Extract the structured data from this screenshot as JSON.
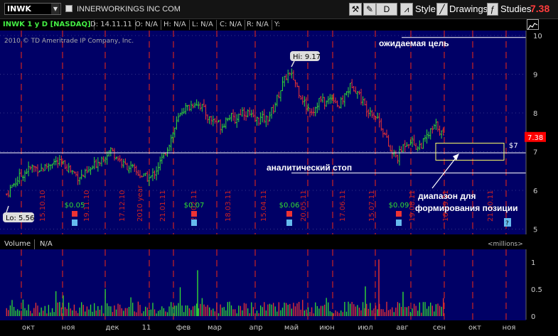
{
  "toolbar": {
    "symbol": "INWK",
    "company": "INNERWORKINGS INC COM",
    "period_button": "D",
    "style_label": "Style",
    "drawings_label": "Drawings",
    "studies_label": "Studies",
    "last_price": "7.38"
  },
  "infobar": {
    "title": "INWK 1 y D [NASDAQ]",
    "date": "D: 14.11.11",
    "open": "O: N/A",
    "high": "H: N/A",
    "low": "L: N/A",
    "close": "C: N/A",
    "range": "R: N/A",
    "y": "Y:"
  },
  "copyright": "2010 © TD Ameritrade IP Company, Inc.",
  "colors": {
    "background": "#000066",
    "up_bar": "#33dd33",
    "down_bar": "#ee3333",
    "grid_dashed": "#cc2222",
    "annotation": "#ffffff",
    "position_box": "#ffff66",
    "price_tag": "#ff0000"
  },
  "chart_data": {
    "type": "ohlc",
    "price_axis": {
      "ticks": [
        "10",
        "9",
        "8",
        "7",
        "6",
        "5"
      ],
      "range": [
        5,
        10.1
      ]
    },
    "month_labels": [
      "окт",
      "ноя",
      "дек",
      "11",
      "фев",
      "мар",
      "апр",
      "май",
      "июн",
      "июл",
      "авг",
      "сен",
      "окт",
      "ноя"
    ],
    "date_labels": [
      "15.10.10",
      "19.11.10",
      "17.12.10",
      "2010 year",
      "21.01.11",
      "21.02.11",
      "18.03.11",
      "15.04.11",
      "20.05.11",
      "17.06.11",
      "15.07.11",
      "19.08.11",
      "16.09.11",
      "21.10.11"
    ],
    "dividend_labels": [
      "$0.05",
      "$0.07",
      "$0.06",
      "$0.09"
    ],
    "hi_label": "Hi: 9.17",
    "lo_label": "Lo: 5.56",
    "close_series": [
      5.9,
      6.15,
      6.35,
      6.5,
      6.6,
      6.55,
      6.6,
      6.75,
      6.7,
      6.65,
      6.5,
      6.35,
      6.4,
      6.55,
      6.75,
      6.9,
      7.05,
      6.85,
      6.65,
      6.6,
      6.45,
      6.35,
      6.3,
      6.55,
      6.85,
      7.25,
      7.7,
      8.1,
      8.15,
      8.3,
      8.15,
      7.85,
      7.8,
      7.65,
      7.95,
      7.8,
      8.05,
      8.0,
      7.8,
      7.85,
      7.85,
      8.15,
      8.6,
      9.0,
      8.9,
      8.5,
      8.15,
      8.05,
      8.35,
      8.25,
      8.45,
      8.15,
      8.5,
      8.75,
      8.5,
      8.15,
      8.05,
      7.85,
      7.45,
      6.95,
      6.85,
      7.2,
      7.3,
      7.1,
      7.25,
      7.5,
      7.7,
      7.38
    ],
    "annotations": {
      "target_label": "ожидаемая цель",
      "stop_label": "аналитический стоп",
      "range_label_1": "диапазон для",
      "range_label_2": "формирования позиции",
      "box_price_label": "$7",
      "target_price": 9.95,
      "stop_price": 6.45,
      "support_price": 6.97,
      "box_low": 6.78,
      "box_high": 7.22
    },
    "volume_axis": {
      "ticks": [
        "1",
        "0.5",
        "0"
      ],
      "range": [
        0,
        1.1
      ],
      "units": "<millions>"
    }
  },
  "volume_panel": {
    "label": "Volume",
    "value": "N/A",
    "units": "<millions>"
  }
}
